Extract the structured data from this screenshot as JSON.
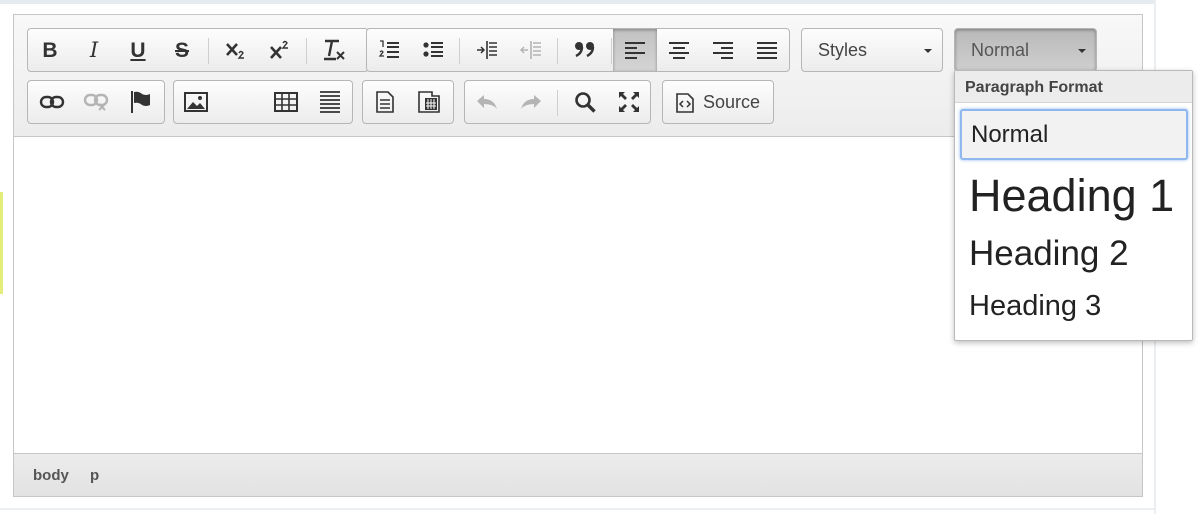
{
  "toolbar": {
    "styles_label": "Styles",
    "format_label": "Normal",
    "source_label": "Source"
  },
  "format_panel": {
    "title": "Paragraph Format",
    "items": [
      "Normal",
      "Heading 1",
      "Heading 2",
      "Heading 3"
    ],
    "selected": "Normal"
  },
  "statusbar": {
    "path": [
      "body",
      "p"
    ]
  },
  "colors": {
    "toolbar_bg": "#ececec",
    "border": "#c6c6c6",
    "focus_ring": "#8fb8ee"
  }
}
